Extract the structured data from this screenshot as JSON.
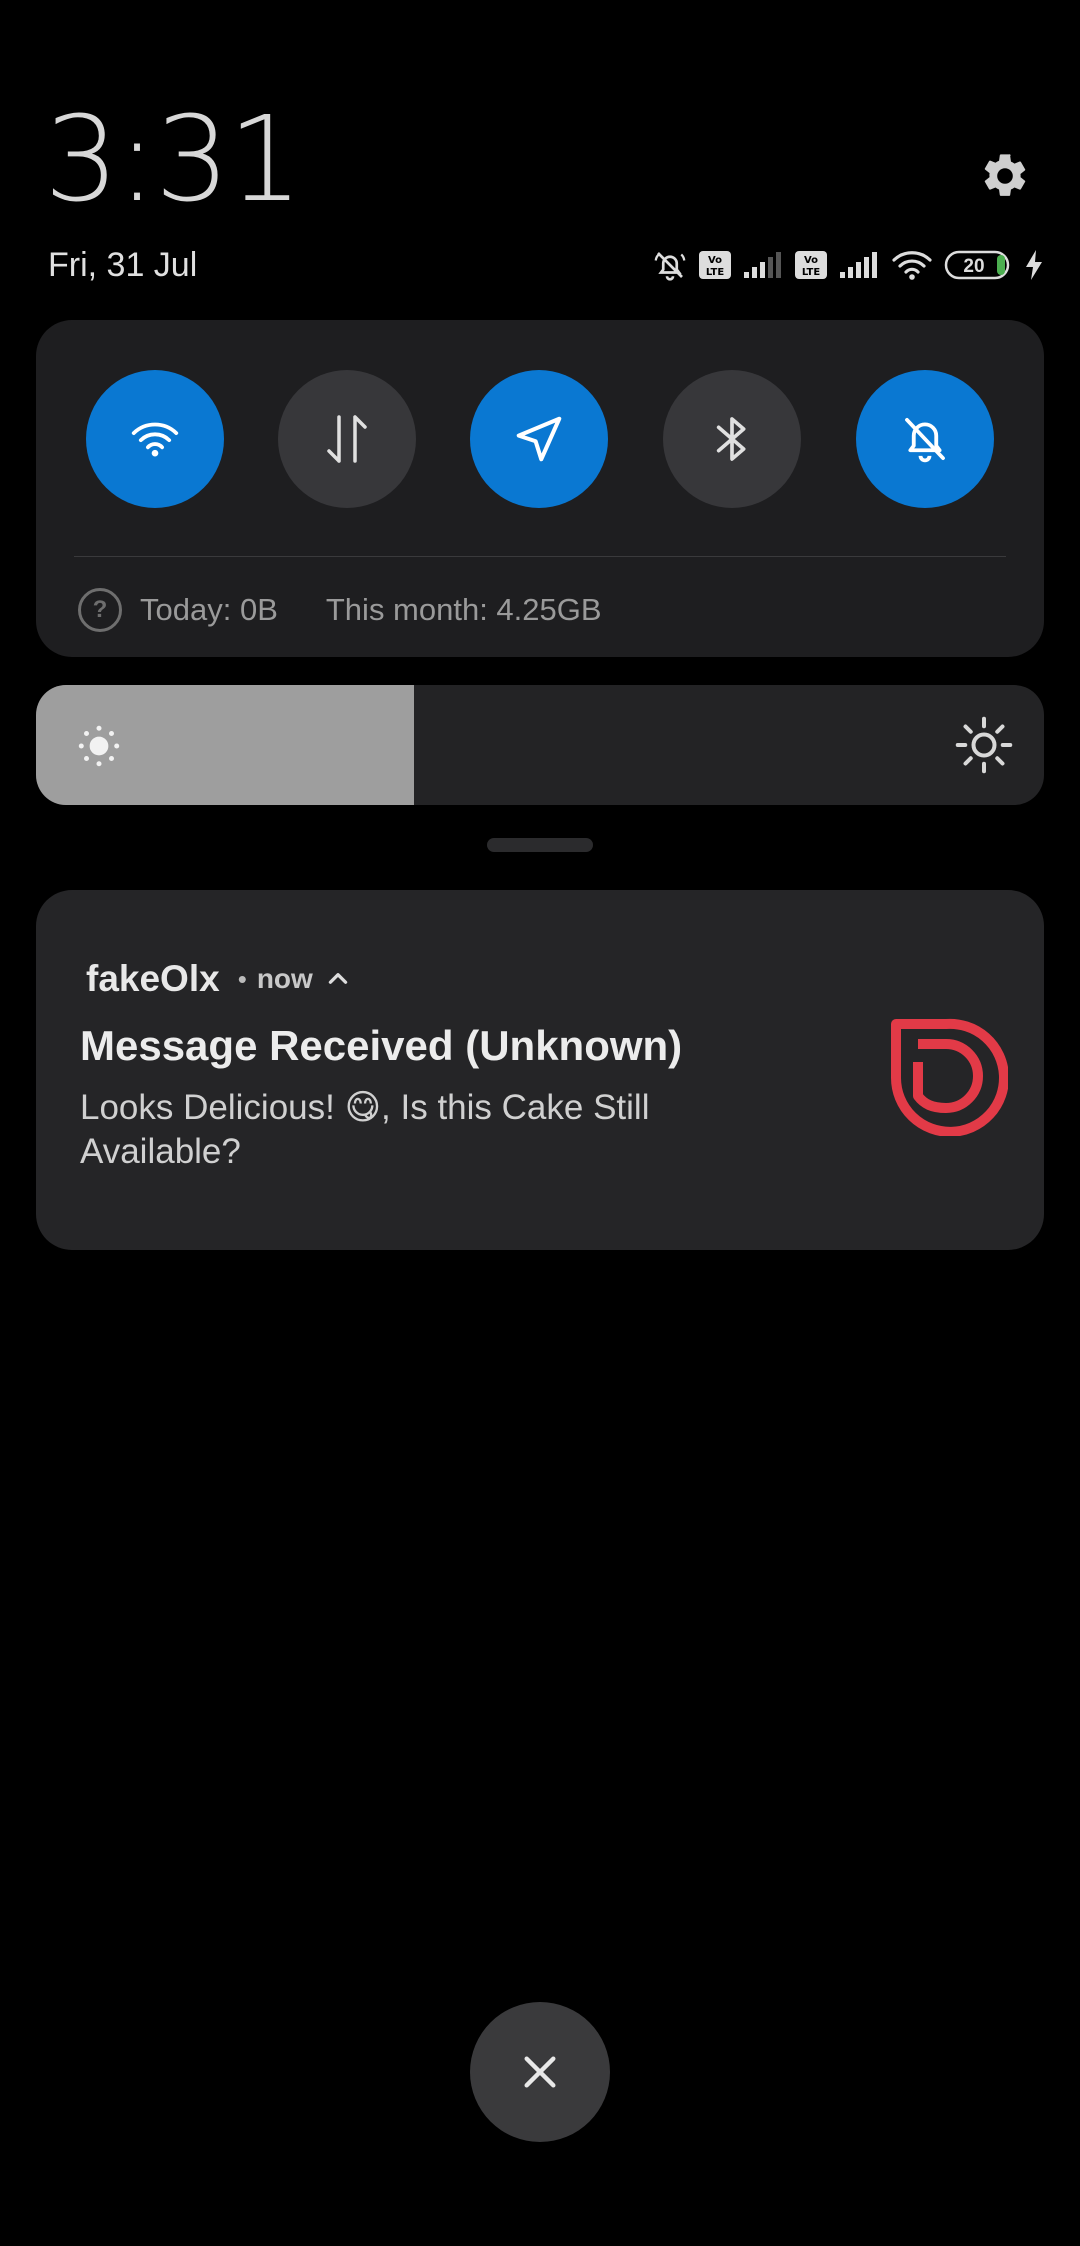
{
  "header": {
    "time": "3:31",
    "date": "Fri, 31 Jul",
    "settings_icon": "gear-icon"
  },
  "status_bar": {
    "battery_level": "20",
    "icons": [
      "ringer-off-icon",
      "volte-icon",
      "signal-icon",
      "volte-icon",
      "signal-icon",
      "wifi-icon",
      "battery-icon",
      "charging-icon"
    ]
  },
  "quick_settings": {
    "toggles": [
      {
        "icon": "wifi-icon",
        "state": "on"
      },
      {
        "icon": "mobile-data-icon",
        "state": "off"
      },
      {
        "icon": "location-icon",
        "state": "on"
      },
      {
        "icon": "bluetooth-icon",
        "state": "off"
      },
      {
        "icon": "silent-mode-icon",
        "state": "on"
      }
    ],
    "data_today": "Today: 0B",
    "data_month": "This month: 4.25GB",
    "help_glyph": "?"
  },
  "brightness": {
    "level": 0.375
  },
  "notification": {
    "app_name": "fakeOlx",
    "separator": "•",
    "time": "now",
    "title": "Message Received (Unknown)",
    "body": "Looks Delicious! 😋, Is this Cake Still Available?",
    "logo": "olx-logo"
  },
  "colors": {
    "accent_on": "#0a78d2",
    "toggle_off": "#37373a",
    "logo_red": "#e23a47"
  },
  "dismiss": {
    "icon": "close-icon"
  }
}
